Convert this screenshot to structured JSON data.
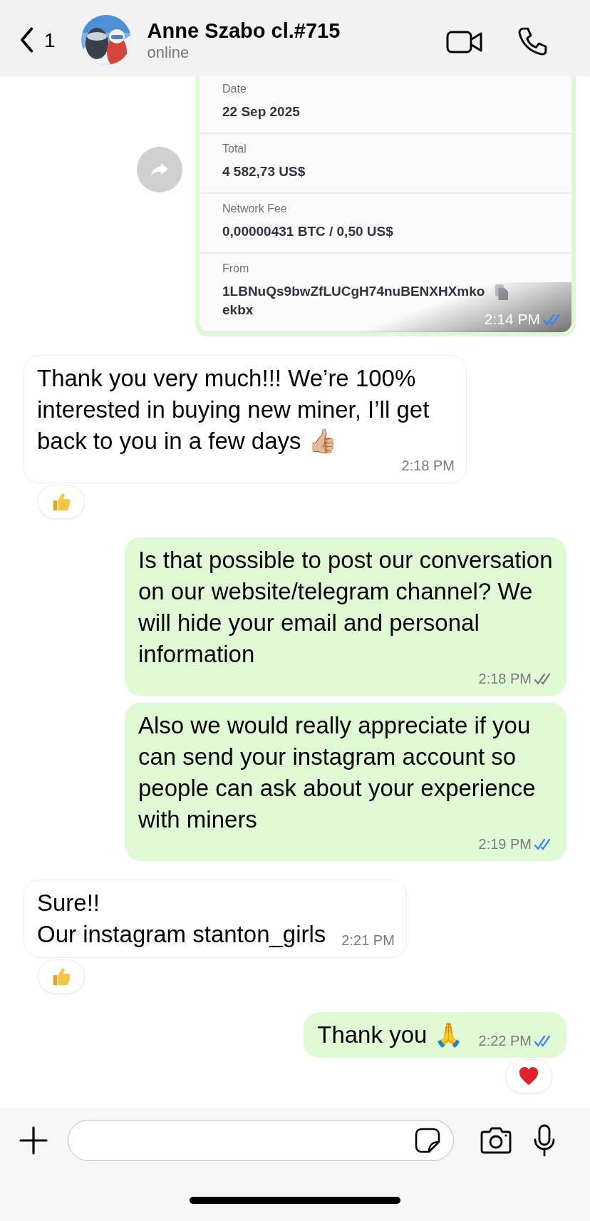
{
  "header": {
    "back_count": "1",
    "name": "Anne Szabo cl.#715",
    "status": "online"
  },
  "receipt": {
    "rows": [
      {
        "label": "Date",
        "value": "22 Sep 2025",
        "kind": "text"
      },
      {
        "label": "Total",
        "value": "4 582,73 US$",
        "kind": "text"
      },
      {
        "label": "Network Fee",
        "value": "0,00000431 BTC / 0,50 US$",
        "kind": "text"
      },
      {
        "label": "From",
        "value": "1LBNuQs9bwZfLUCgH74nuBENXHXmkoekbx",
        "kind": "address"
      }
    ],
    "time": "2:14 PM",
    "read": true
  },
  "messages": [
    {
      "kind": "incoming",
      "text": "Thank you very much!!! We’re 100% interested in buying new miner, I’ll get back to you in a few days 👍🏼",
      "time": "2:18 PM",
      "reaction": {
        "kind": "thumbs_up"
      }
    },
    {
      "kind": "outgoing",
      "text": "Is that possible to post our conversation on our website/telegram channel? We will hide your email and personal information",
      "time": "2:18 PM",
      "read": false
    },
    {
      "kind": "outgoing",
      "text": "Also we would really appreciate if you can send your instagram account so people can ask about your experience with miners",
      "time": "2:19 PM",
      "read": true
    },
    {
      "kind": "incoming",
      "text": "Sure!!\nOur instagram stanton_girls",
      "time": "2:21 PM",
      "reaction": {
        "kind": "thumbs_up"
      }
    },
    {
      "kind": "outgoing",
      "text": "Thank you 🙏",
      "time": "2:22 PM",
      "read": true,
      "reaction": {
        "kind": "heart"
      }
    }
  ]
}
